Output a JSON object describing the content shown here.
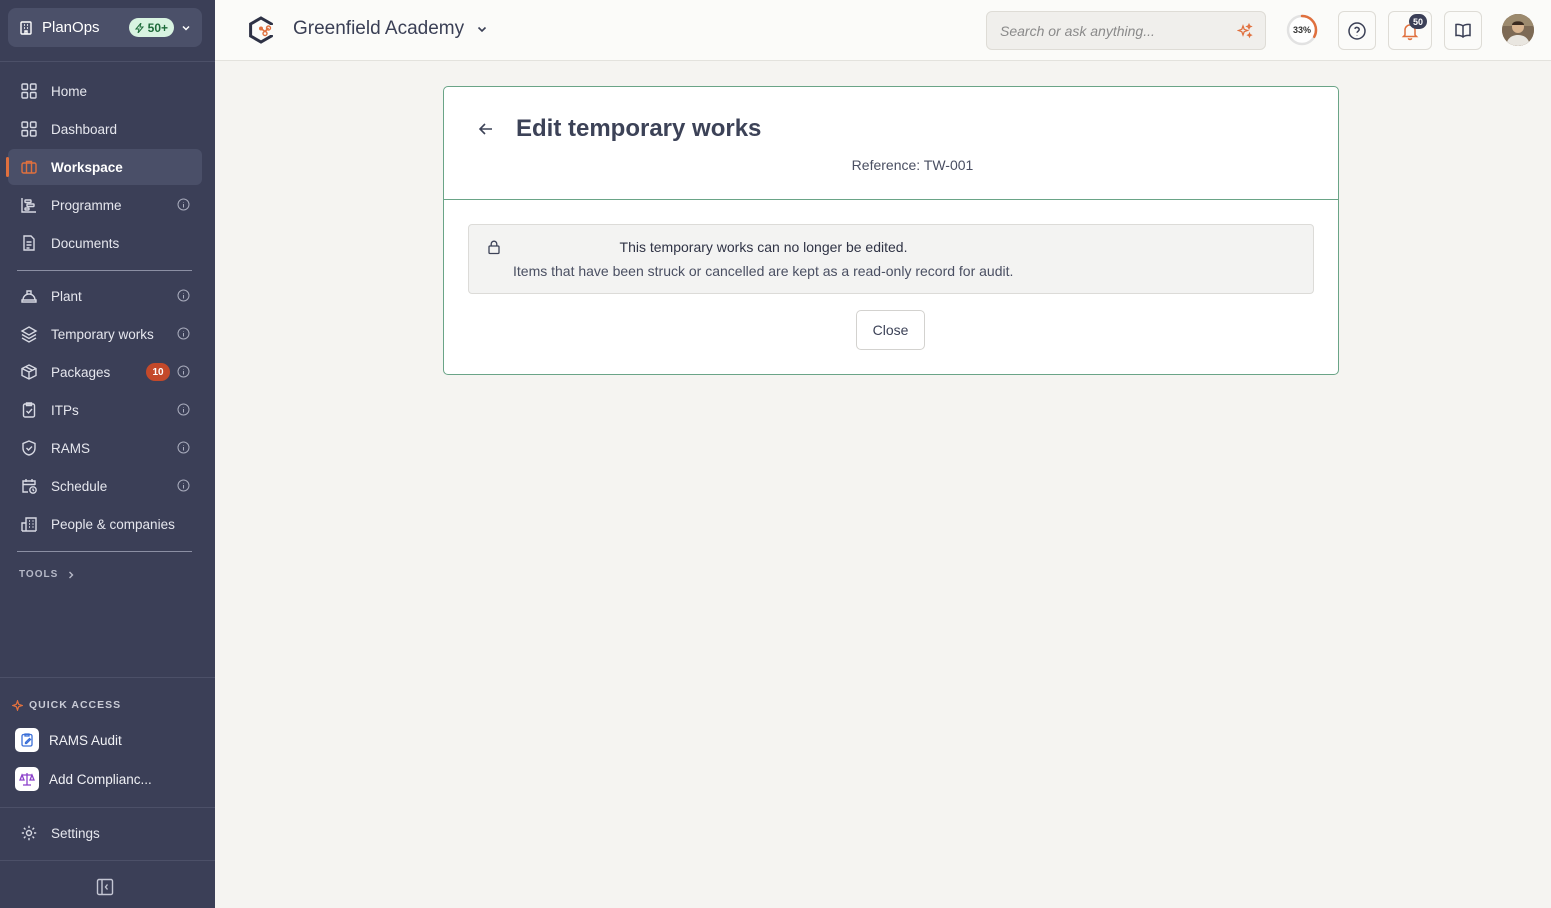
{
  "app": {
    "name": "PlanOps",
    "badge": "50+"
  },
  "sidebar": {
    "items": [
      {
        "label": "Home",
        "icon": "grid-icon"
      },
      {
        "label": "Dashboard",
        "icon": "dashboard-icon"
      },
      {
        "label": "Workspace",
        "icon": "briefcase-icon",
        "active": true
      },
      {
        "label": "Programme",
        "icon": "gantt-icon",
        "info": true
      },
      {
        "label": "Documents",
        "icon": "document-icon"
      },
      {
        "label": "Plant",
        "icon": "hardhat-icon",
        "info": true
      },
      {
        "label": "Temporary works",
        "icon": "layers-icon",
        "info": true
      },
      {
        "label": "Packages",
        "icon": "package-icon",
        "info": true,
        "count": "10"
      },
      {
        "label": "ITPs",
        "icon": "clipboard-check-icon",
        "info": true
      },
      {
        "label": "RAMS",
        "icon": "shield-check-icon",
        "info": true
      },
      {
        "label": "Schedule",
        "icon": "calendar-clock-icon",
        "info": true
      },
      {
        "label": "People & companies",
        "icon": "building-icon"
      }
    ],
    "tools_label": "TOOLS",
    "quick_access": {
      "title": "QUICK ACCESS",
      "items": [
        {
          "label": "RAMS Audit",
          "icon": "clipboard-edit-icon"
        },
        {
          "label": "Add Complianc...",
          "icon": "scales-icon"
        }
      ]
    },
    "settings_label": "Settings"
  },
  "header": {
    "project": "Greenfield Academy",
    "search_placeholder": "Search or ask anything...",
    "progress": "33%",
    "progress_value": 0.33,
    "notifications": "50"
  },
  "card": {
    "title": "Edit temporary works",
    "reference": "Reference: TW-001",
    "notice_title": "This temporary works can no longer be edited.",
    "notice_body": "Items that have been struck or cancelled are kept as a read-only record for audit.",
    "close_label": "Close"
  },
  "colors": {
    "sidebar_bg": "#3b3f57",
    "accent": "#e0703e",
    "card_border": "#6aa487",
    "badge_red": "#c4492a"
  }
}
